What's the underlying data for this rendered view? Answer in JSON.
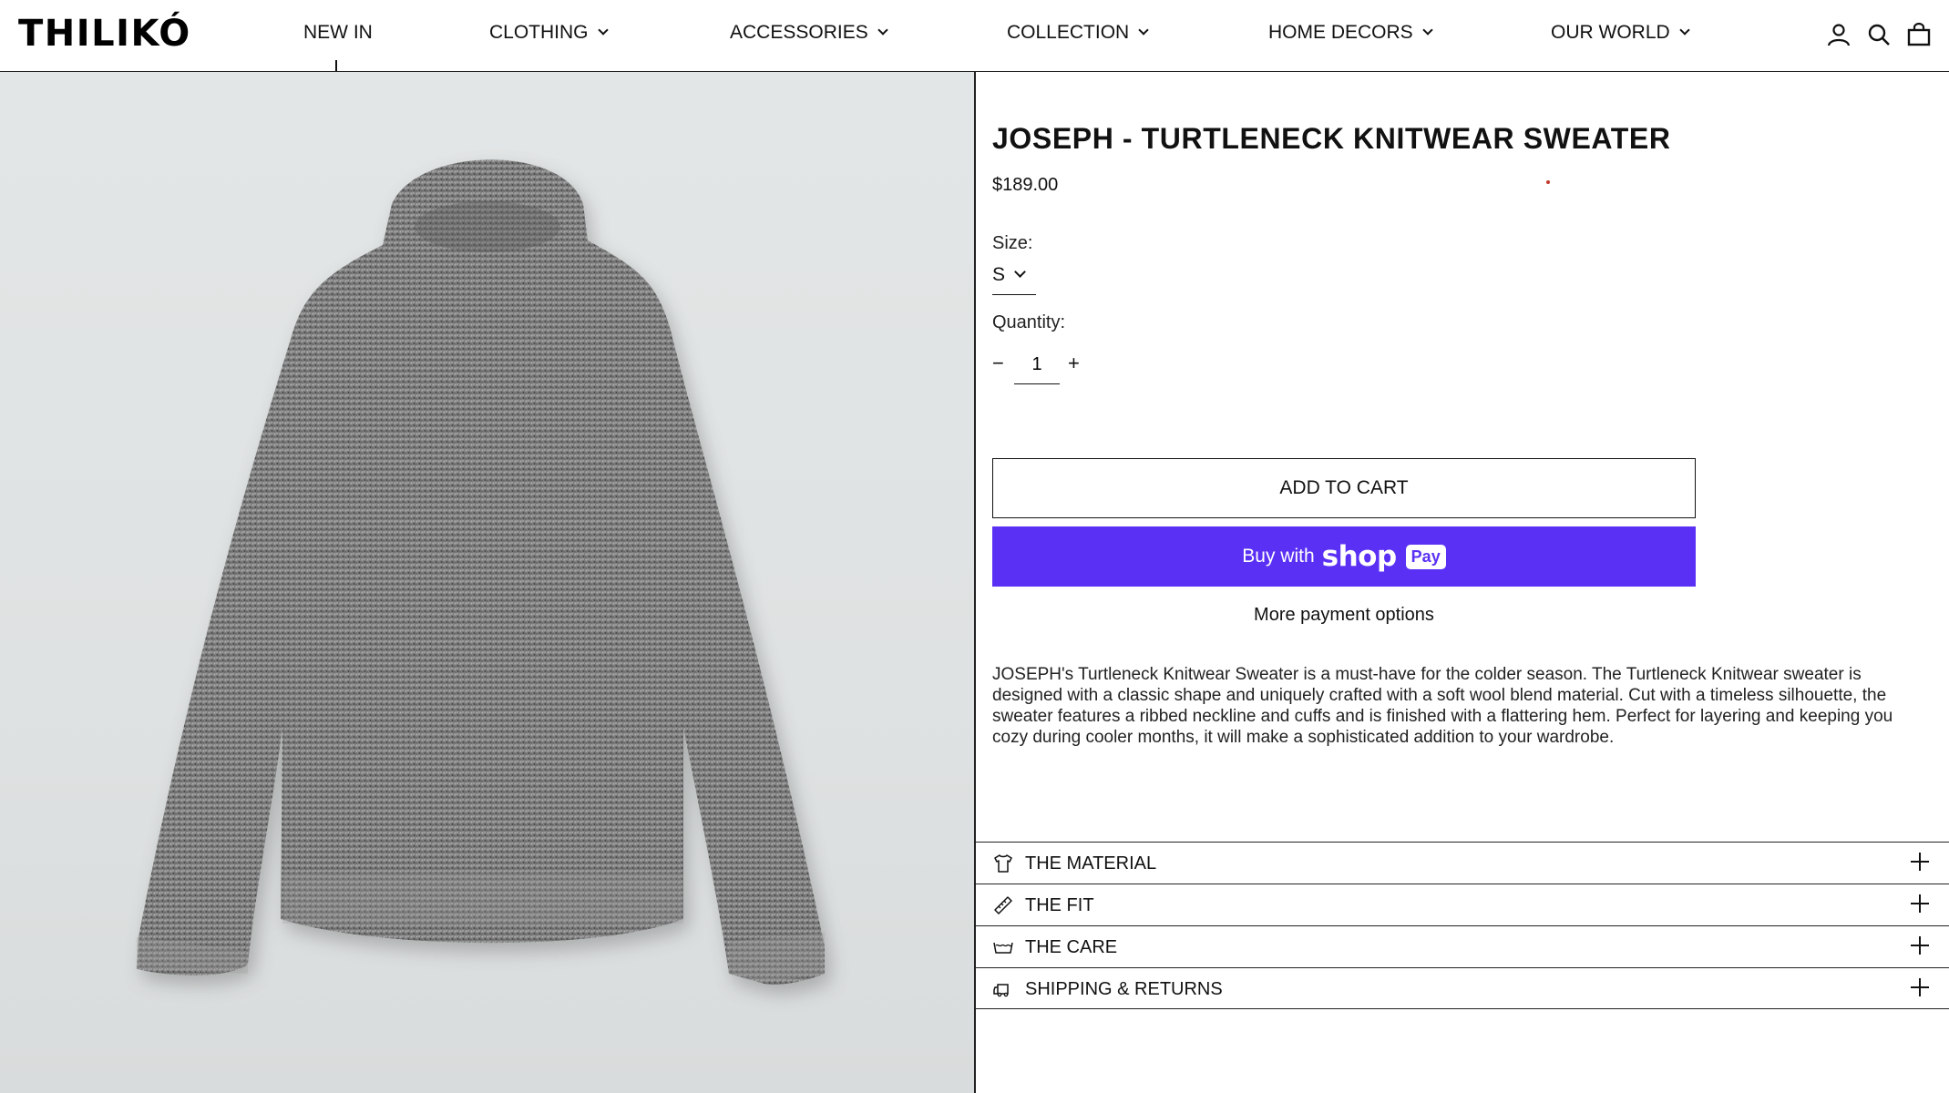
{
  "header": {
    "logo": "THILIKÓ",
    "nav": [
      {
        "label": "NEW IN",
        "has_dropdown": false
      },
      {
        "label": "CLOTHING",
        "has_dropdown": true
      },
      {
        "label": "ACCESSORIES",
        "has_dropdown": true
      },
      {
        "label": "COLLECTION",
        "has_dropdown": true
      },
      {
        "label": "HOME DECORS",
        "has_dropdown": true
      },
      {
        "label": "OUR WORLD",
        "has_dropdown": true
      }
    ],
    "icons": [
      "account-icon",
      "search-icon",
      "cart-icon"
    ]
  },
  "product": {
    "title": "JOSEPH - TURTLENECK KNITWEAR SWEATER",
    "price": "$189.00",
    "size_label": "Size:",
    "size_value": "S",
    "quantity_label": "Quantity:",
    "quantity_minus": "−",
    "quantity_value": "1",
    "quantity_plus": "+",
    "add_to_cart": "ADD TO CART",
    "buy_with": "Buy with",
    "shop_word": "shop",
    "pay_word": "Pay",
    "more_payment": "More payment options",
    "description": "JOSEPH's Turtleneck Knitwear Sweater is a must-have for the colder season. The Turtleneck Knitwear sweater is designed with a classic shape and uniquely crafted with a soft wool blend material. Cut with a timeless silhouette, the sweater features a ribbed neckline and cuffs and is finished with a flattering hem. Perfect for layering and keeping you cozy during cooler months, it will make a sophisticated addition to your wardrobe."
  },
  "accordion": [
    {
      "label": "THE MATERIAL",
      "icon": "shirt-icon"
    },
    {
      "label": "THE FIT",
      "icon": "ruler-icon"
    },
    {
      "label": "THE CARE",
      "icon": "washing-icon"
    },
    {
      "label": "SHIPPING & RETURNS",
      "icon": "truck-icon"
    }
  ],
  "colors": {
    "shop_pay": "#5a31f4",
    "text": "#111111",
    "image_bg": "#e0e3e3",
    "sweater": "#7a7a7a"
  }
}
